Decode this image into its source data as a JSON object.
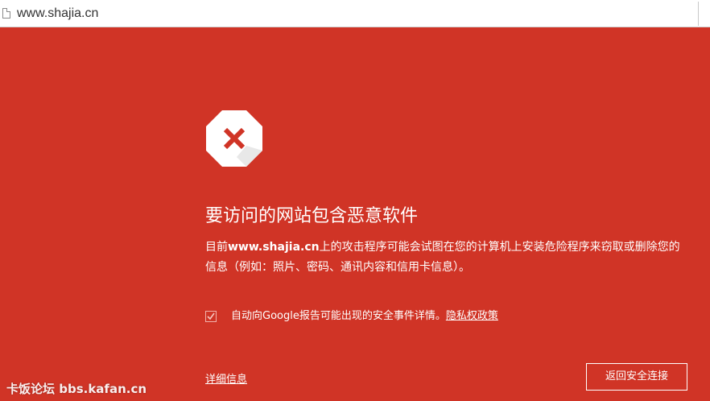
{
  "browser": {
    "url": "www.shajia.cn",
    "page_icon": "page-icon"
  },
  "interstitial": {
    "background_color": "#d03426",
    "icon": "malware-x-octagon-icon",
    "title": "要访问的网站包含恶意软件",
    "body_prefix": "目前",
    "body_site": "www.shajia.cn",
    "body_suffix": "上的攻击程序可能会试图在您的计算机上安装危险程序来窃取或删除您的信息（例如：照片、密码、通讯内容和信用卡信息）。",
    "report_checkbox": {
      "checked": true,
      "label": "自动向Google报告可能出现的安全事件详情。",
      "link": "隐私权政策"
    },
    "details_link": "详细信息",
    "back_button": "返回安全连接"
  },
  "watermark": "卡饭论坛 bbs.kafan.cn"
}
